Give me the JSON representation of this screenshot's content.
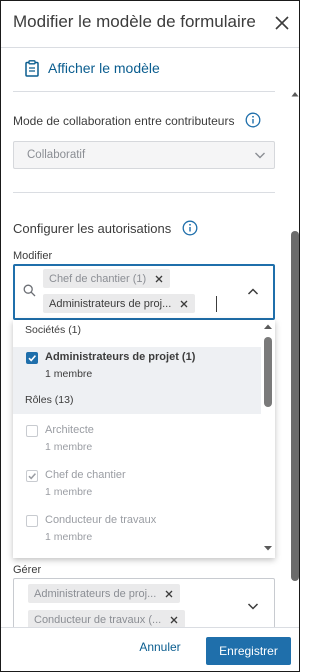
{
  "header": {
    "title": "Modifier le modèle de formulaire",
    "close_icon": "close-icon"
  },
  "template_link": {
    "label": "Afficher le modèle",
    "icon": "clipboard-icon"
  },
  "collaboration": {
    "label": "Mode de collaboration entre contributeurs",
    "value": "Collaboratif"
  },
  "permissions": {
    "title": "Configurer les autorisations"
  },
  "modify": {
    "label": "Modifier",
    "chips": [
      "Chef de chantier (1)",
      "Administrateurs de proj..."
    ]
  },
  "dropdown": {
    "groups": [
      {
        "label": "Sociétés (1)",
        "options": [
          {
            "name": "Administrateurs de projet (1)",
            "sub": "1 membre",
            "checked": true,
            "disabled": false
          }
        ]
      },
      {
        "label": "Rôles (13)",
        "options": [
          {
            "name": "Architecte",
            "sub": "1 membre",
            "checked": false,
            "disabled": true
          },
          {
            "name": "Chef de chantier",
            "sub": "1 membre",
            "checked": true,
            "disabled": true
          },
          {
            "name": "Conducteur de travaux",
            "sub": "1 membre",
            "checked": false,
            "disabled": true
          }
        ]
      }
    ]
  },
  "manage": {
    "label": "Gérer",
    "chips": [
      "Administrateurs de proj...",
      "Conducteur de travaux (..."
    ]
  },
  "footer": {
    "cancel": "Annuler",
    "save": "Enregistrer"
  },
  "colors": {
    "accent": "#1f6fab",
    "link": "#0a5d8f",
    "text": "#3c3c3c"
  }
}
